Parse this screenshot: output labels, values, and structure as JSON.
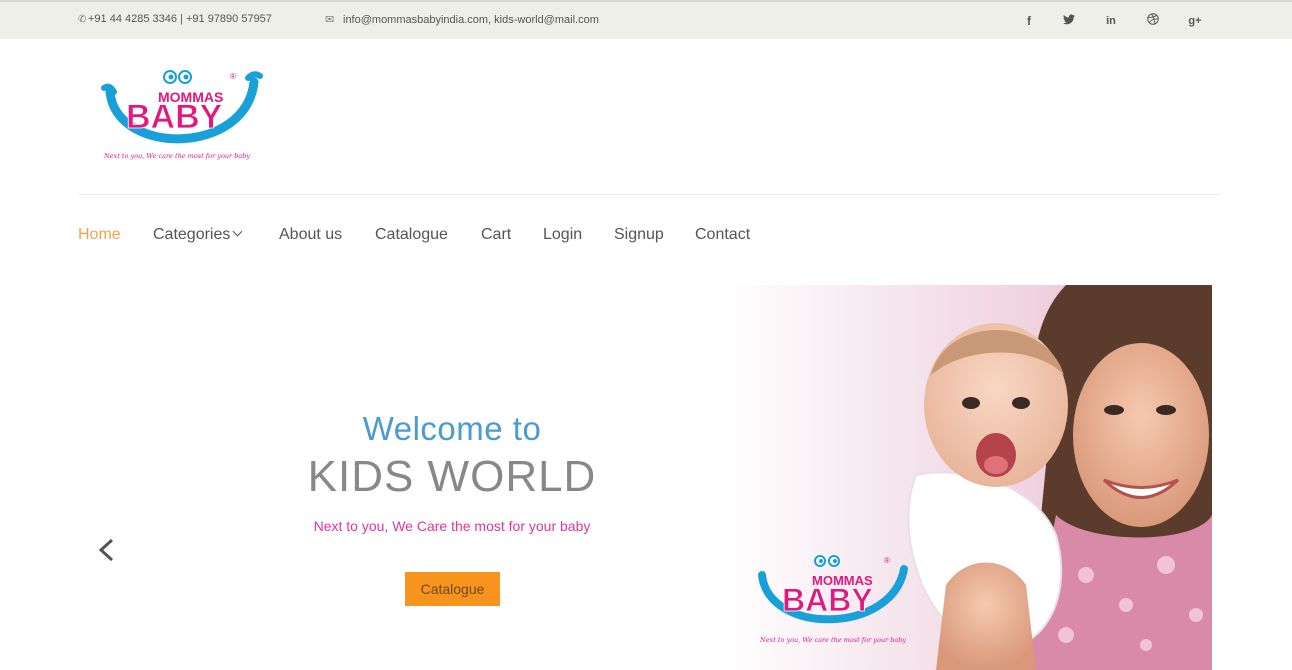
{
  "topbar": {
    "phone": "+91 44 4285 3346  | +91 97890 57957",
    "email": "info@mommasbabyindia.com, kids-world@mail.com",
    "social": [
      {
        "icon": "facebook-icon",
        "glyph": "f"
      },
      {
        "icon": "twitter-icon",
        "glyph": "t"
      },
      {
        "icon": "linkedin-icon",
        "glyph": "in"
      },
      {
        "icon": "dribbble-icon",
        "glyph": "◎"
      },
      {
        "icon": "google-plus-icon",
        "glyph": "g+"
      }
    ]
  },
  "logo": {
    "top": "MOMMAS",
    "main": "BABY",
    "tagline": "Next to you, We care the most for your baby"
  },
  "nav": {
    "items": [
      {
        "label": "Home",
        "active": true
      },
      {
        "label": "Categories",
        "dropdown": true
      },
      {
        "label": "About us"
      },
      {
        "label": "Catalogue"
      },
      {
        "label": "Cart"
      },
      {
        "label": "Login"
      },
      {
        "label": "Signup"
      },
      {
        "label": "Contact"
      }
    ]
  },
  "hero": {
    "welcome": "Welcome to",
    "title": "KIDS WORLD",
    "tagline": "Next to you, We Care the most for your baby",
    "button": "Catalogue"
  },
  "colors": {
    "accent": "#f6a04d",
    "button": "#f8931d",
    "welcome": "#4a9ad4",
    "pink": "#e233a3"
  }
}
